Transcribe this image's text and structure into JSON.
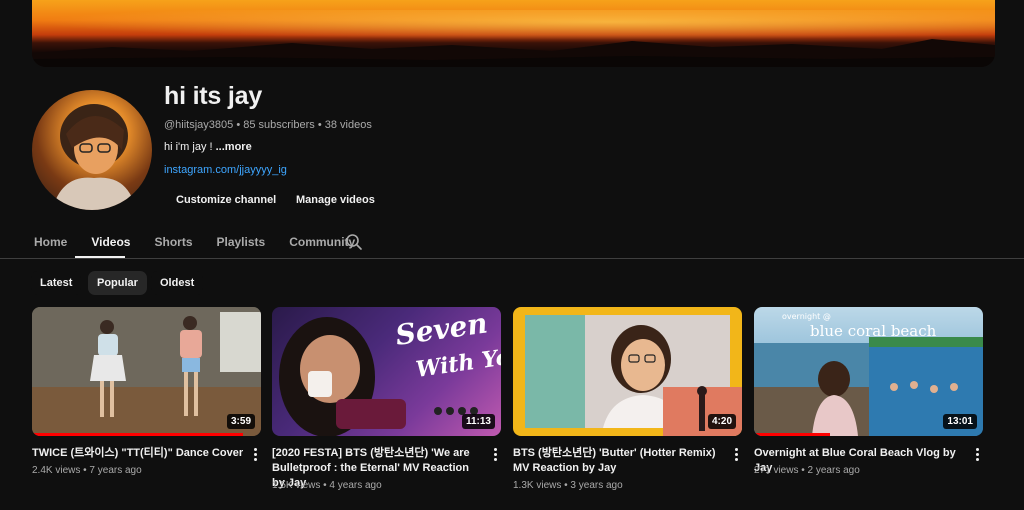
{
  "channel": {
    "name": "hi its jay",
    "handle": "@hiitsjay3805",
    "separator": " • ",
    "subscribers": "85 subscribers",
    "video_count": "38 videos",
    "description": "hi i'm jay ! ",
    "more_label": "...more",
    "link": "instagram.com/jjayyyy_ig"
  },
  "actions": {
    "customize_label": "Customize channel",
    "manage_label": "Manage videos"
  },
  "tabs": [
    {
      "label": "Home",
      "active": false
    },
    {
      "label": "Videos",
      "active": true
    },
    {
      "label": "Shorts",
      "active": false
    },
    {
      "label": "Playlists",
      "active": false
    },
    {
      "label": "Community",
      "active": false
    }
  ],
  "filters": [
    {
      "label": "Latest",
      "selected": false
    },
    {
      "label": "Popular",
      "selected": true
    },
    {
      "label": "Oldest",
      "selected": false
    }
  ],
  "videos": [
    {
      "title": "TWICE (트와이스) \"TT(티티)\" Dance Cover",
      "duration": "3:59",
      "views": "2.4K views",
      "age": "7 years ago",
      "watched_fraction": 0.92
    },
    {
      "title": "[2020 FESTA] BTS (방탄소년단) 'We are Bulletproof : the Eternal' MV Reaction by Jay",
      "duration": "11:13",
      "views": "1.5K views",
      "age": "4 years ago",
      "thumb_text": "We are not Seven With You",
      "watched_fraction": 0
    },
    {
      "title": "BTS (방탄소년단) 'Butter' (Hotter Remix) MV Reaction by Jay",
      "duration": "4:20",
      "views": "1.3K views",
      "age": "3 years ago",
      "watched_fraction": 0
    },
    {
      "title": "Overnight at Blue Coral Beach Vlog by Jay",
      "duration": "13:01",
      "views": "271 views",
      "age": "2 years ago",
      "thumb_text_small": "overnight @",
      "thumb_text_big": "blue coral beach",
      "watched_fraction": 0.33
    }
  ],
  "colors": {
    "background": "#0f0f0f",
    "accent_link": "#3ea6ff",
    "progress": "#ff0000",
    "chip_selected": "#272727"
  }
}
